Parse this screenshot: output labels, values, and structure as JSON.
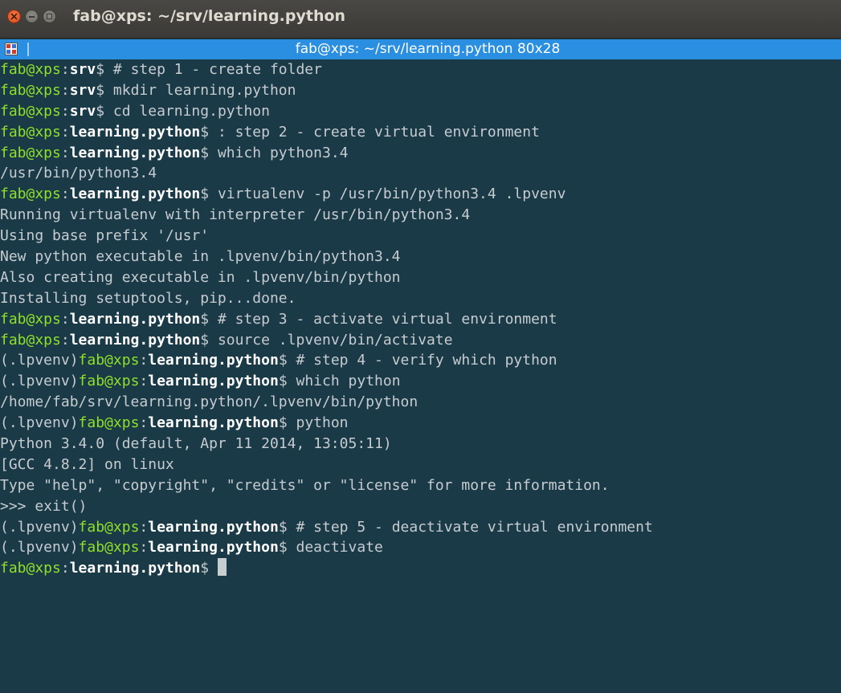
{
  "window": {
    "title": "fab@xps: ~/srv/learning.python"
  },
  "tab": {
    "title": "fab@xps: ~/srv/learning.python 80x28"
  },
  "colors": {
    "background": "#1a3a47",
    "prompt_user": "#8ee02a",
    "text": "#c6ccd0",
    "path": "#ffffff",
    "tabbar": "#2a8fe0",
    "close_button": "#e35a27"
  },
  "terminal": {
    "prompt_user_host": "fab@xps",
    "venv_prefix": "(.lpvenv)",
    "lines": [
      {
        "type": "prompt",
        "venv": false,
        "path": "srv",
        "cmd": " # step 1 - create folder"
      },
      {
        "type": "prompt",
        "venv": false,
        "path": "srv",
        "cmd": " mkdir learning.python"
      },
      {
        "type": "prompt",
        "venv": false,
        "path": "srv",
        "cmd": " cd learning.python"
      },
      {
        "type": "prompt",
        "venv": false,
        "path": "learning.python",
        "cmd": " : step 2 - create virtual environment"
      },
      {
        "type": "prompt",
        "venv": false,
        "path": "learning.python",
        "cmd": " which python3.4"
      },
      {
        "type": "output",
        "text": "/usr/bin/python3.4"
      },
      {
        "type": "prompt",
        "venv": false,
        "path": "learning.python",
        "cmd": " virtualenv -p /usr/bin/python3.4 .lpvenv"
      },
      {
        "type": "output",
        "text": "Running virtualenv with interpreter /usr/bin/python3.4"
      },
      {
        "type": "output",
        "text": "Using base prefix '/usr'"
      },
      {
        "type": "output",
        "text": "New python executable in .lpvenv/bin/python3.4"
      },
      {
        "type": "output",
        "text": "Also creating executable in .lpvenv/bin/python"
      },
      {
        "type": "output",
        "text": "Installing setuptools, pip...done."
      },
      {
        "type": "prompt",
        "venv": false,
        "path": "learning.python",
        "cmd": " # step 3 - activate virtual environment"
      },
      {
        "type": "prompt",
        "venv": false,
        "path": "learning.python",
        "cmd": " source .lpvenv/bin/activate"
      },
      {
        "type": "prompt",
        "venv": true,
        "path": "learning.python",
        "cmd": " # step 4 - verify which python"
      },
      {
        "type": "prompt",
        "venv": true,
        "path": "learning.python",
        "cmd": " which python"
      },
      {
        "type": "output",
        "text": "/home/fab/srv/learning.python/.lpvenv/bin/python"
      },
      {
        "type": "prompt",
        "venv": true,
        "path": "learning.python",
        "cmd": " python"
      },
      {
        "type": "output",
        "text": "Python 3.4.0 (default, Apr 11 2014, 13:05:11)"
      },
      {
        "type": "output",
        "text": "[GCC 4.8.2] on linux"
      },
      {
        "type": "output",
        "text": "Type \"help\", \"copyright\", \"credits\" or \"license\" for more information."
      },
      {
        "type": "output",
        "text": ">>> exit()"
      },
      {
        "type": "prompt",
        "venv": true,
        "path": "learning.python",
        "cmd": " # step 5 - deactivate virtual environment"
      },
      {
        "type": "prompt",
        "venv": true,
        "path": "learning.python",
        "cmd": " deactivate"
      },
      {
        "type": "prompt",
        "venv": false,
        "path": "learning.python",
        "cmd": " ",
        "cursor": true
      }
    ]
  }
}
